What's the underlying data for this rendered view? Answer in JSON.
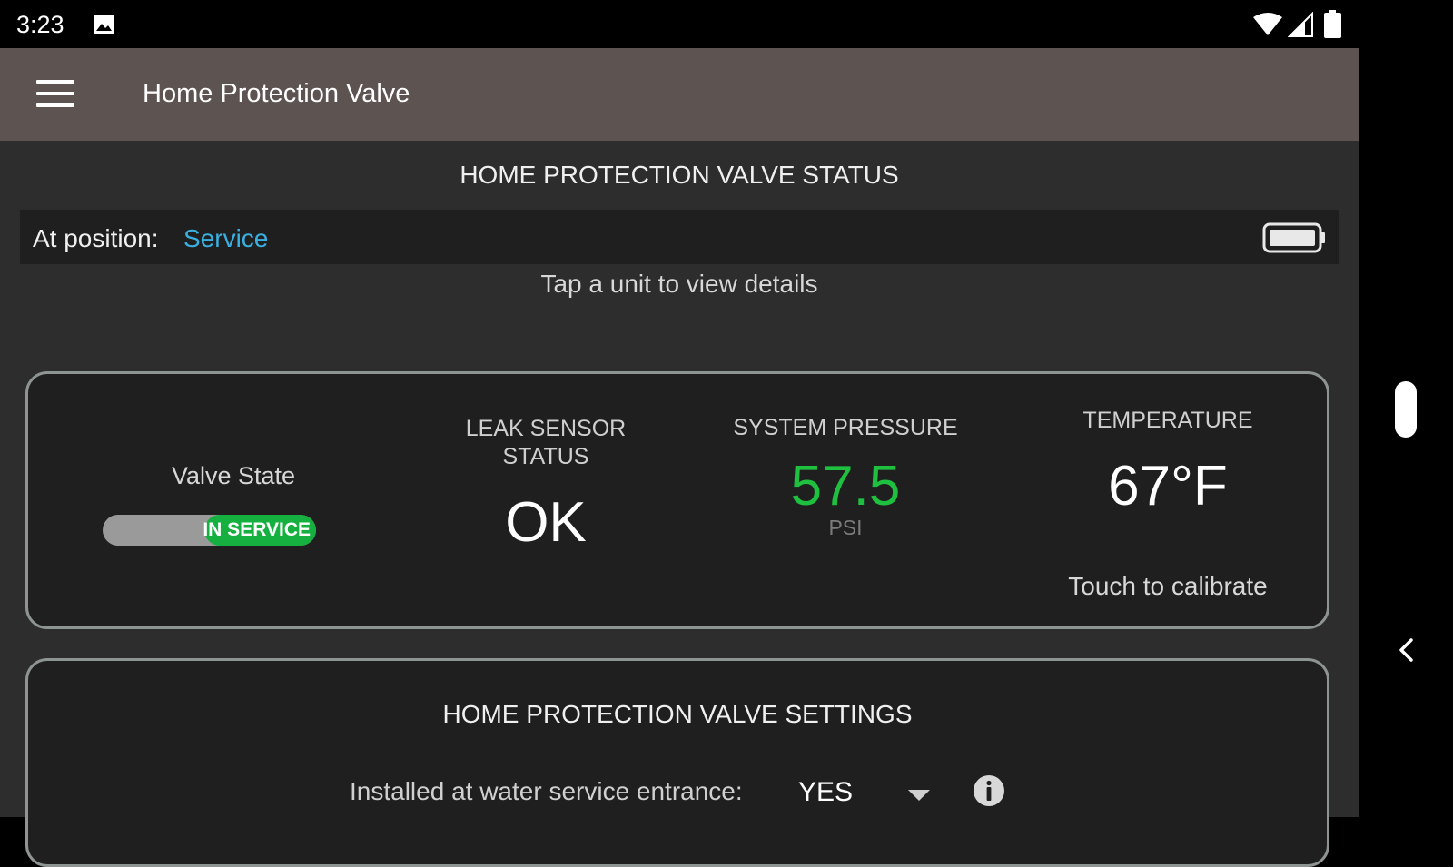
{
  "status_bar": {
    "time": "3:23",
    "icons": [
      "image-icon",
      "wifi-icon",
      "signal-icon",
      "battery-icon"
    ]
  },
  "app_bar": {
    "title": "Home Protection Valve",
    "menu_icon": "menu-icon"
  },
  "status_section": {
    "title": "HOME PROTECTION VALVE STATUS",
    "position_label": "At position:",
    "position_value": "Service",
    "hint": "Tap a unit to view details"
  },
  "status_card": {
    "valve_state_label": "Valve State",
    "valve_toggle_text": "IN SERVICE",
    "leak_title_line1": "LEAK SENSOR",
    "leak_title_line2": "STATUS",
    "leak_value": "OK",
    "pressure_title": "SYSTEM PRESSURE",
    "pressure_value": "57.5",
    "pressure_unit": "PSI",
    "temperature_title": "TEMPERATURE",
    "temperature_value": "67°F",
    "calibrate_hint": "Touch to calibrate"
  },
  "settings_card": {
    "title": "HOME PROTECTION VALVE SETTINGS",
    "installed_label": "Installed at water service entrance:",
    "installed_value": "YES"
  },
  "colors": {
    "accent_blue": "#3ab0e0",
    "pressure_green": "#1fc040",
    "toggle_green": "#15b040",
    "app_bar": "#5d5350",
    "background": "#2d2d2d",
    "card": "#1f1f1f"
  }
}
